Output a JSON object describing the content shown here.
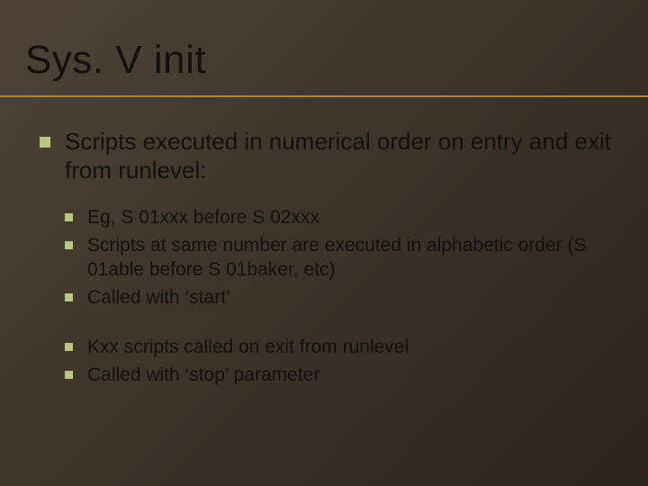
{
  "title": "Sys. V init",
  "l1_text": "Scripts executed in numerical order on entry and exit from runlevel:",
  "group1": [
    "Eg, S 01xxx before S 02xxx",
    "Scripts at same number are executed in alphabetic order (S 01able before S 01baker, etc)",
    "Called with ‘start’"
  ],
  "group2": [
    "Kxx scripts called on exit from runlevel",
    "Called with ‘stop’ parameter"
  ]
}
